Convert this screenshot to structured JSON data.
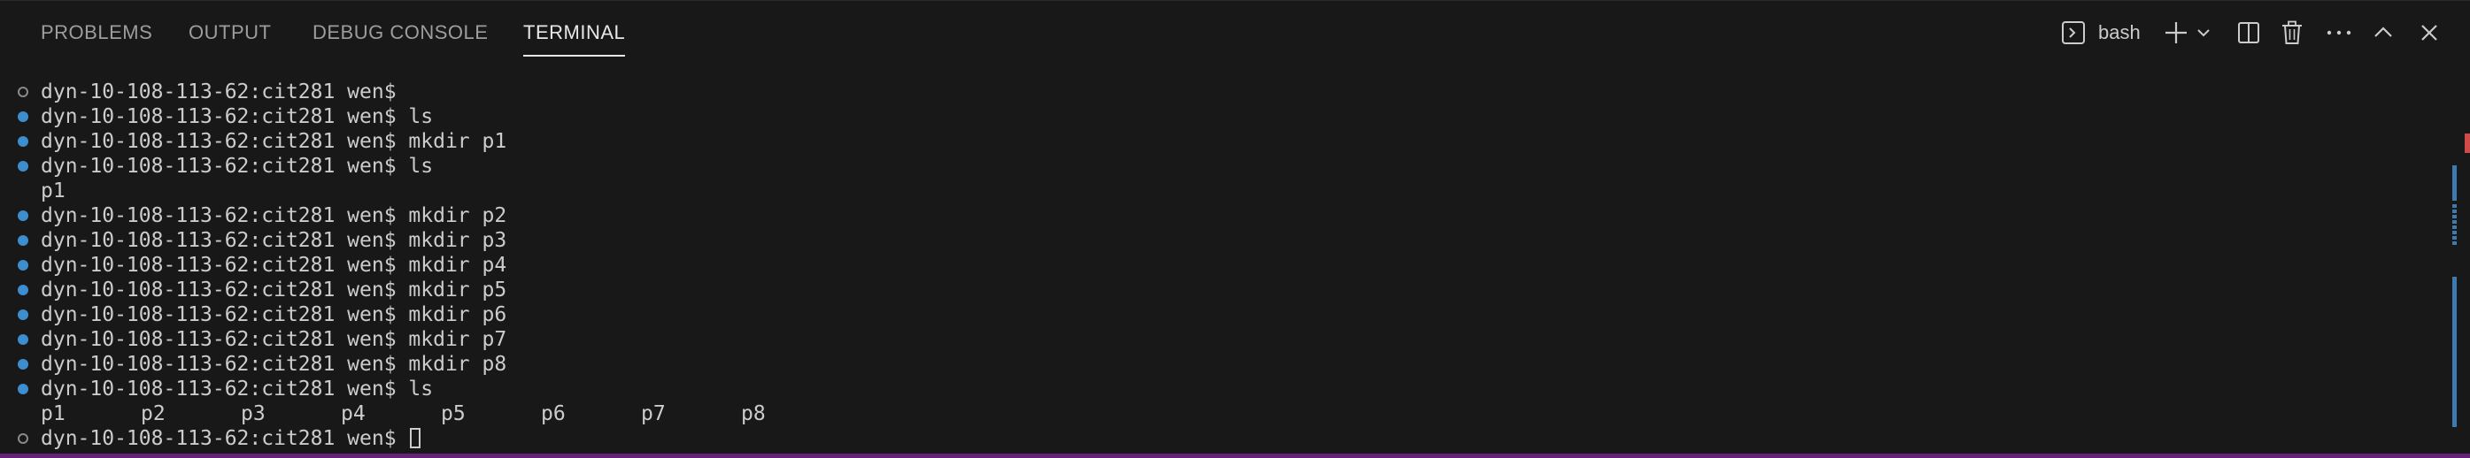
{
  "tabs": [
    {
      "label": "PROBLEMS",
      "active": false
    },
    {
      "label": "OUTPUT",
      "active": false
    },
    {
      "label": "DEBUG CONSOLE",
      "active": false
    },
    {
      "label": "TERMINAL",
      "active": true
    }
  ],
  "actions": {
    "terminal_name": "bash",
    "icons": [
      "terminal-icon",
      "plus-icon",
      "chevron-down-icon",
      "split-icon",
      "trash-icon",
      "ellipsis-icon",
      "chevron-up-icon",
      "close-icon"
    ]
  },
  "terminal": {
    "lines": [
      {
        "text": "dyn-10-108-113-62:cit281 wen$",
        "decoration": "none"
      },
      {
        "text": "dyn-10-108-113-62:cit281 wen$ ls",
        "decoration": "success"
      },
      {
        "text": "dyn-10-108-113-62:cit281 wen$ mkdir p1",
        "decoration": "success"
      },
      {
        "text": "dyn-10-108-113-62:cit281 wen$ ls",
        "decoration": "success"
      },
      {
        "text": "p1",
        "decoration": ""
      },
      {
        "text": "dyn-10-108-113-62:cit281 wen$ mkdir p2",
        "decoration": "success"
      },
      {
        "text": "dyn-10-108-113-62:cit281 wen$ mkdir p3",
        "decoration": "success"
      },
      {
        "text": "dyn-10-108-113-62:cit281 wen$ mkdir p4",
        "decoration": "success"
      },
      {
        "text": "dyn-10-108-113-62:cit281 wen$ mkdir p5",
        "decoration": "success"
      },
      {
        "text": "dyn-10-108-113-62:cit281 wen$ mkdir p6",
        "decoration": "success"
      },
      {
        "text": "dyn-10-108-113-62:cit281 wen$ mkdir p7",
        "decoration": "success"
      },
      {
        "text": "dyn-10-108-113-62:cit281 wen$ mkdir p8",
        "decoration": "success"
      },
      {
        "text": "dyn-10-108-113-62:cit281 wen$ ls",
        "decoration": "success"
      }
    ],
    "ls_output": [
      "p1",
      "p2",
      "p3",
      "p4",
      "p5",
      "p6",
      "p7",
      "p8"
    ],
    "prompt": "dyn-10-108-113-62:cit281 wen$"
  },
  "colors": {
    "background": "#181818",
    "foreground": "#cccccc",
    "decoration_success": "#3c8ed0",
    "accent_bar": "#68217a"
  }
}
